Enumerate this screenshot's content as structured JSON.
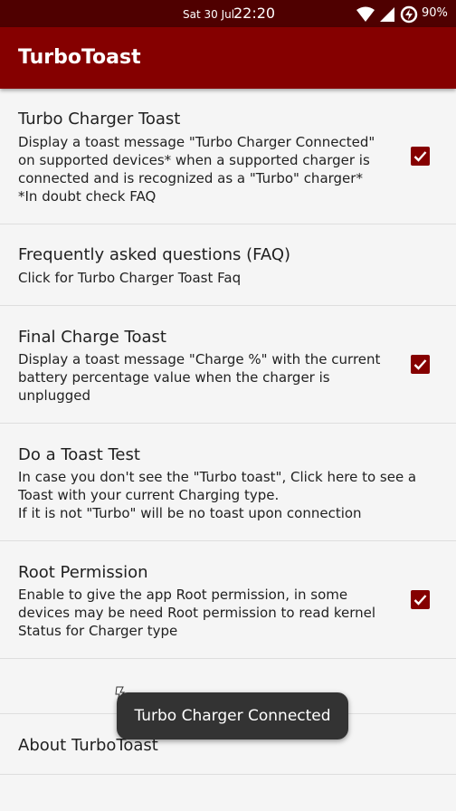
{
  "status_bar": {
    "date": "Sat 30 Jul",
    "time": "22:20",
    "battery": "90%"
  },
  "app_bar": {
    "title": "TurboToast"
  },
  "preferences": [
    {
      "title": "Turbo Charger Toast",
      "summary": [
        "Display a toast message \"Turbo Charger Connected\"",
        "on supported devices* when a supported charger is",
        "connected and is recognized as a \"Turbo\" charger*",
        "*In doubt check FAQ"
      ],
      "checked": true
    },
    {
      "title": "Frequently asked questions (FAQ)",
      "summary": [
        "Click for Turbo Charger Toast Faq"
      ]
    },
    {
      "title": "Final Charge Toast",
      "summary": [
        "Display a toast message \"Charge %\" with the current",
        "battery percentage value when the charger is",
        "unplugged"
      ],
      "checked": true
    },
    {
      "title": "Do a Toast Test",
      "summary": [
        "In case you don't see the \"Turbo toast\", Click here to see a",
        "Toast with your current Charging type.",
        "If it is not \"Turbo\" will be no toast upon connection"
      ]
    },
    {
      "title": "Root Permission",
      "summary": [
        "Enable to give the app Root permission, in some",
        "devices may be need Root permission to read kernel",
        "Status for Charger type"
      ],
      "checked": true
    },
    {
      "title": "About TurboToast"
    }
  ],
  "toast": {
    "message": "Turbo Charger Connected"
  },
  "colors": {
    "status_bar": "#4f0000",
    "app_bar": "#850000",
    "accent": "#850000",
    "background": "#f5f5f5"
  }
}
